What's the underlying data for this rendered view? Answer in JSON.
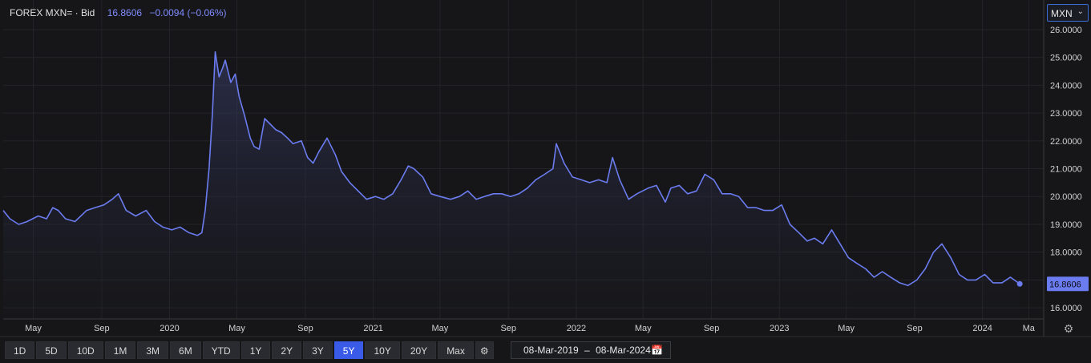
{
  "header": {
    "symbol": "FOREX MXN= · Bid",
    "price": "16.8606",
    "change": "−0.0094 (−0.06%)"
  },
  "currency": {
    "label": "MXN",
    "chevron_icon": "chevron-down-icon"
  },
  "last_price_tag": "16.8606",
  "range_buttons": [
    "1D",
    "5D",
    "10D",
    "1M",
    "3M",
    "6M",
    "YTD",
    "1Y",
    "2Y",
    "3Y",
    "5Y",
    "10Y",
    "20Y",
    "Max"
  ],
  "active_range": "5Y",
  "date_range": {
    "start": "08-Mar-2019",
    "separator": "–",
    "end": "08-Mar-2024",
    "icon": "calendar-icon"
  },
  "colors": {
    "line": "#6b7cf0",
    "accent": "#3a5be8",
    "background": "#161618",
    "grid": "#2a2a2e"
  },
  "chart_data": {
    "type": "area",
    "title": "",
    "y_axis_position": "right",
    "ylim": [
      15.6,
      26.2
    ],
    "y_ticks": [
      "16.0000",
      "17.0000",
      "18.0000",
      "19.0000",
      "20.0000",
      "21.0000",
      "22.0000",
      "23.0000",
      "24.0000",
      "25.0000",
      "26.0000"
    ],
    "x_ticks": [
      "May",
      "Sep",
      "2020",
      "May",
      "Sep",
      "2021",
      "May",
      "Sep",
      "2022",
      "May",
      "Sep",
      "2023",
      "May",
      "Sep",
      "2024",
      "Ma"
    ],
    "xlim": [
      "2019-03-08",
      "2024-04-20"
    ],
    "grid": true,
    "series": [
      {
        "x": [
          "2019-03-08",
          "2019-03-20",
          "2019-04-05",
          "2019-04-20",
          "2019-05-10",
          "2019-05-25",
          "2019-06-05",
          "2019-06-15",
          "2019-06-28",
          "2019-07-15",
          "2019-08-05",
          "2019-08-20",
          "2019-09-05",
          "2019-09-20",
          "2019-10-01",
          "2019-10-15",
          "2019-11-01",
          "2019-11-20",
          "2019-12-05",
          "2019-12-20",
          "2020-01-05",
          "2020-01-20",
          "2020-02-05",
          "2020-02-20",
          "2020-02-28",
          "2020-03-05",
          "2020-03-12",
          "2020-03-18",
          "2020-03-23",
          "2020-03-30",
          "2020-04-05",
          "2020-04-10",
          "2020-04-20",
          "2020-04-28",
          "2020-05-05",
          "2020-05-15",
          "2020-05-25",
          "2020-06-01",
          "2020-06-10",
          "2020-06-20",
          "2020-06-30",
          "2020-07-10",
          "2020-07-20",
          "2020-07-31",
          "2020-08-10",
          "2020-08-25",
          "2020-09-05",
          "2020-09-15",
          "2020-09-25",
          "2020-10-10",
          "2020-10-25",
          "2020-11-05",
          "2020-11-20",
          "2020-12-05",
          "2020-12-20",
          "2021-01-05",
          "2021-01-20",
          "2021-02-05",
          "2021-02-20",
          "2021-03-05",
          "2021-03-15",
          "2021-03-31",
          "2021-04-15",
          "2021-05-01",
          "2021-05-20",
          "2021-06-05",
          "2021-06-20",
          "2021-07-05",
          "2021-07-20",
          "2021-08-05",
          "2021-08-20",
          "2021-09-05",
          "2021-09-20",
          "2021-10-05",
          "2021-10-20",
          "2021-11-05",
          "2021-11-20",
          "2021-11-26",
          "2021-12-10",
          "2021-12-25",
          "2022-01-10",
          "2022-01-25",
          "2022-02-10",
          "2022-02-25",
          "2022-03-07",
          "2022-03-20",
          "2022-04-05",
          "2022-04-20",
          "2022-05-10",
          "2022-05-25",
          "2022-06-10",
          "2022-06-20",
          "2022-07-05",
          "2022-07-20",
          "2022-08-05",
          "2022-08-20",
          "2022-09-05",
          "2022-09-20",
          "2022-10-05",
          "2022-10-20",
          "2022-11-05",
          "2022-11-20",
          "2022-12-05",
          "2022-12-20",
          "2023-01-05",
          "2023-01-20",
          "2023-02-05",
          "2023-02-20",
          "2023-03-05",
          "2023-03-20",
          "2023-04-05",
          "2023-04-20",
          "2023-05-05",
          "2023-05-20",
          "2023-06-05",
          "2023-06-20",
          "2023-07-05",
          "2023-07-20",
          "2023-08-05",
          "2023-08-20",
          "2023-09-05",
          "2023-09-20",
          "2023-10-05",
          "2023-10-20",
          "2023-11-05",
          "2023-11-20",
          "2023-12-05",
          "2023-12-20",
          "2024-01-05",
          "2024-01-20",
          "2024-02-05",
          "2024-02-20",
          "2024-03-08"
        ],
        "y": [
          19.5,
          19.2,
          19.0,
          19.1,
          19.3,
          19.2,
          19.6,
          19.5,
          19.2,
          19.1,
          19.5,
          19.6,
          19.7,
          19.9,
          20.1,
          19.5,
          19.3,
          19.5,
          19.1,
          18.9,
          18.8,
          18.9,
          18.7,
          18.6,
          18.7,
          19.5,
          21.0,
          23.0,
          25.2,
          24.3,
          24.6,
          24.9,
          24.1,
          24.4,
          23.6,
          22.9,
          22.1,
          21.8,
          21.7,
          22.8,
          22.6,
          22.4,
          22.3,
          22.1,
          21.9,
          22.0,
          21.4,
          21.2,
          21.6,
          22.1,
          21.5,
          20.9,
          20.5,
          20.2,
          19.9,
          20.0,
          19.9,
          20.1,
          20.6,
          21.1,
          21.0,
          20.7,
          20.1,
          20.0,
          19.9,
          20.0,
          20.2,
          19.9,
          20.0,
          20.1,
          20.1,
          20.0,
          20.1,
          20.3,
          20.6,
          20.8,
          21.0,
          21.9,
          21.2,
          20.7,
          20.6,
          20.5,
          20.6,
          20.5,
          21.4,
          20.6,
          19.9,
          20.1,
          20.3,
          20.4,
          19.8,
          20.3,
          20.4,
          20.1,
          20.2,
          20.8,
          20.6,
          20.1,
          20.1,
          20.0,
          19.6,
          19.6,
          19.5,
          19.5,
          19.7,
          19.0,
          18.7,
          18.4,
          18.5,
          18.3,
          18.8,
          18.3,
          17.8,
          17.6,
          17.4,
          17.1,
          17.3,
          17.1,
          16.9,
          16.8,
          17.0,
          17.4,
          18.0,
          18.3,
          17.8,
          17.2,
          17.0,
          17.0,
          17.2,
          16.9,
          16.9,
          17.1,
          16.86
        ]
      }
    ]
  }
}
